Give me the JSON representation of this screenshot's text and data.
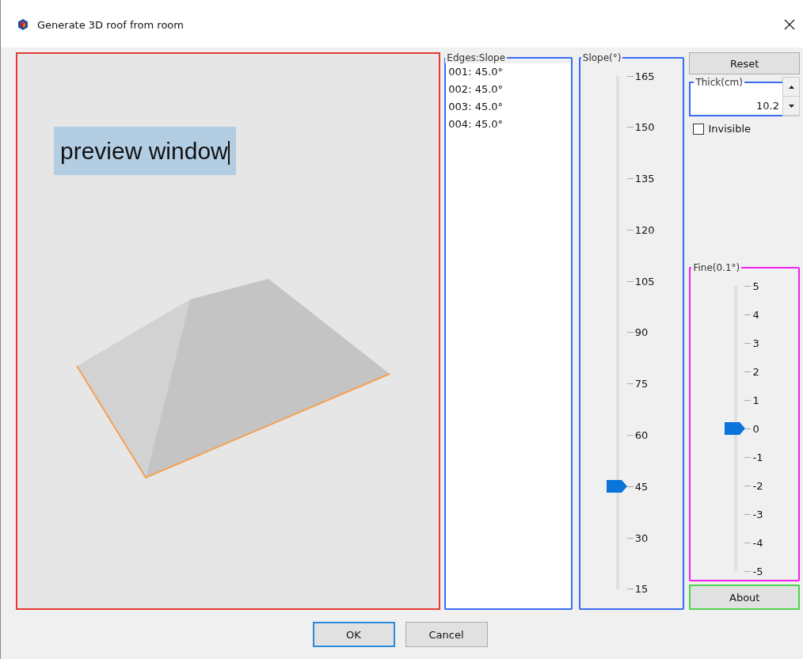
{
  "window": {
    "title": "Generate 3D roof from room"
  },
  "preview": {
    "label": "preview window"
  },
  "edges": {
    "title": "Edges:Slope",
    "items": [
      "001: 45.0°",
      "002: 45.0°",
      "003: 45.0°",
      "004: 45.0°"
    ]
  },
  "slope": {
    "title": "Slope(°)",
    "ticks": [
      "165",
      "150",
      "135",
      "120",
      "105",
      "90",
      "75",
      "60",
      "45",
      "30",
      "15"
    ],
    "level": 0.2
  },
  "reset_button": "Reset",
  "thickness": {
    "label": "Thick(cm)",
    "value": "10.2"
  },
  "invisible": {
    "label": "Invisible",
    "checked": false
  },
  "fine": {
    "title": "Fine(0.1°)",
    "ticks": [
      "5",
      "4",
      "3",
      "2",
      "1",
      "0",
      "-1",
      "-2",
      "-3",
      "-4",
      "-5"
    ],
    "level": 0.5
  },
  "about_button": "About",
  "buttons": [
    "OK",
    "Cancel"
  ]
}
